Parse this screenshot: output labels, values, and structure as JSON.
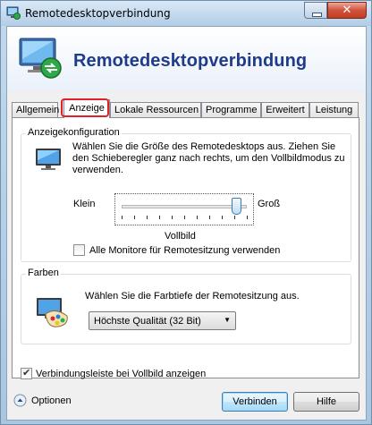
{
  "window": {
    "title": "Remotedesktopverbindung",
    "close_glyph": "✕"
  },
  "banner": {
    "title": "Remotedesktopverbindung"
  },
  "tabs": [
    {
      "label": "Allgemein"
    },
    {
      "label": "Anzeige"
    },
    {
      "label": "Lokale Ressourcen"
    },
    {
      "label": "Programme"
    },
    {
      "label": "Erweitert"
    },
    {
      "label": "Leistung"
    }
  ],
  "display_config": {
    "group_label": "Anzeigekonfiguration",
    "description": "Wählen Sie die Größe des Remotedesktops aus. Ziehen Sie den Schieberegler ganz nach rechts, um den Vollbildmodus zu verwenden.",
    "slider_min_label": "Klein",
    "slider_max_label": "Groß",
    "slider_value_label": "Vollbild",
    "all_monitors_label": "Alle Monitore für Remotesitzung verwenden",
    "all_monitors_checked": false
  },
  "colors_group": {
    "group_label": "Farben",
    "description": "Wählen Sie die Farbtiefe der Remotesitzung aus.",
    "selected_depth": "Höchste Qualität (32 Bit)"
  },
  "connection_bar": {
    "label": "Verbindungsleiste bei Vollbild anzeigen",
    "checked": true
  },
  "footer": {
    "options_label": "Optionen",
    "connect_label": "Verbinden",
    "help_label": "Hilfe"
  },
  "theme": {
    "banner_title_color": "#1f3b8b",
    "tab_highlight_color": "#e0202a"
  }
}
